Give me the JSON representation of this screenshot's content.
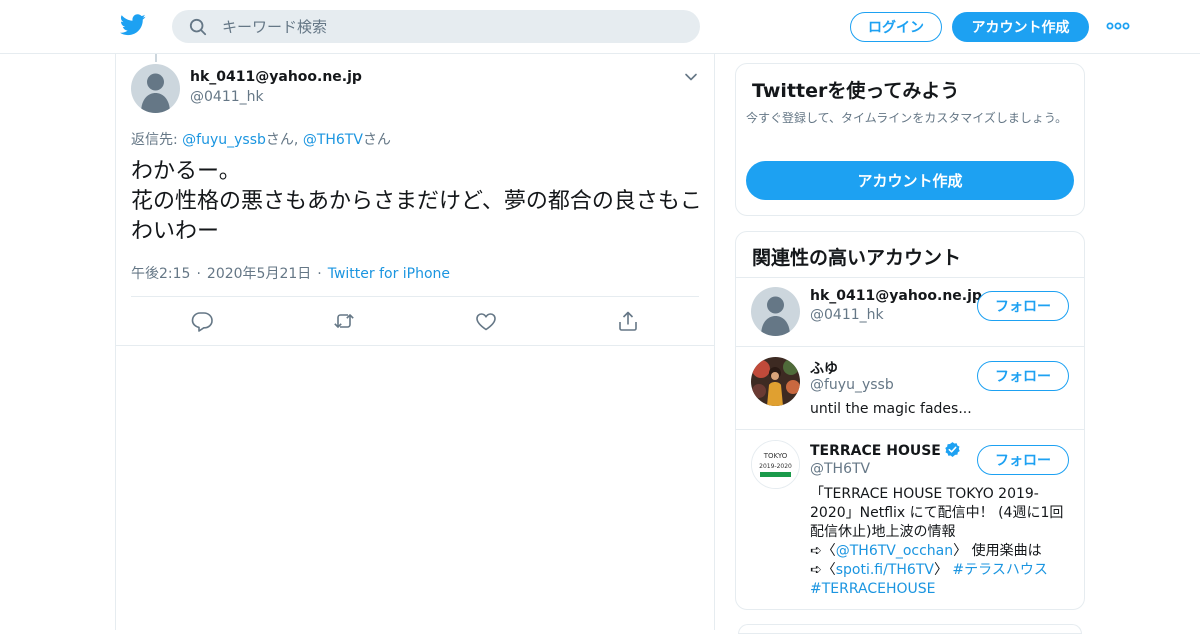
{
  "search": {
    "placeholder": "キーワード検索"
  },
  "header": {
    "login_label": "ログイン",
    "signup_label": "アカウント作成"
  },
  "tweet": {
    "name": "hk_0411@yahoo.ne.jp",
    "handle": "@0411_hk",
    "reply_prefix": "返信先: ",
    "reply_user1": "@fuyu_yssb",
    "reply_san1": "さん, ",
    "reply_user2": "@TH6TV",
    "reply_san2": "さん",
    "text": "わかるー。\n花の性格の悪さもあからさまだけど、夢の都合の良さもこわいわー",
    "time": "午後2:15",
    "date": "2020年5月21日",
    "source": "Twitter for iPhone",
    "separator": "·"
  },
  "signup_card": {
    "title": "Twitterを使ってみよう",
    "description": "今すぐ登録して、タイムラインをカスタマイズしましょう。",
    "button_label": "アカウント作成"
  },
  "related": {
    "title": "関連性の高いアカウント",
    "follow_label": "フォロー",
    "accounts": [
      {
        "name": "hk_0411@yahoo.ne.jp",
        "handle": "@0411_hk",
        "bio": ""
      },
      {
        "name": "ふゆ",
        "handle": "@fuyu_yssb",
        "bio": "until the magic fades..."
      },
      {
        "name": "TERRACE HOUSE",
        "handle": "@TH6TV",
        "verified": true,
        "bio_line1": "「TERRACE HOUSE TOKYO 2019-",
        "bio_line2": "2020」Netflix にて配信中！ (4週に1回",
        "bio_line3": "配信休止)地上波の情報",
        "bio_line4_prefix": "➪〈",
        "bio_line4_link": "@TH6TV_occhan",
        "bio_line4_suffix": "〉 使用楽曲は",
        "bio_line5_prefix": "➪〈",
        "bio_line5_link": "spoti.fi/TH6TV",
        "bio_line5_mid": "〉 ",
        "bio_line5_tag": "#テラスハウス",
        "bio_line6_tag": "#TERRACEHOUSE",
        "logo_text_top": "TOKYO",
        "logo_text_mid": "2019-2020"
      }
    ]
  },
  "colors": {
    "accent": "#1da1f2",
    "link": "#1b95e0",
    "muted": "#657786",
    "border": "#e6ecf0",
    "verified": "#1da1f2"
  },
  "icons": [
    "twitter-bird-icon",
    "search-icon",
    "more-dots-icon",
    "chevron-down-icon",
    "reply-icon",
    "retweet-icon",
    "like-icon",
    "share-icon",
    "verified-badge-icon"
  ]
}
